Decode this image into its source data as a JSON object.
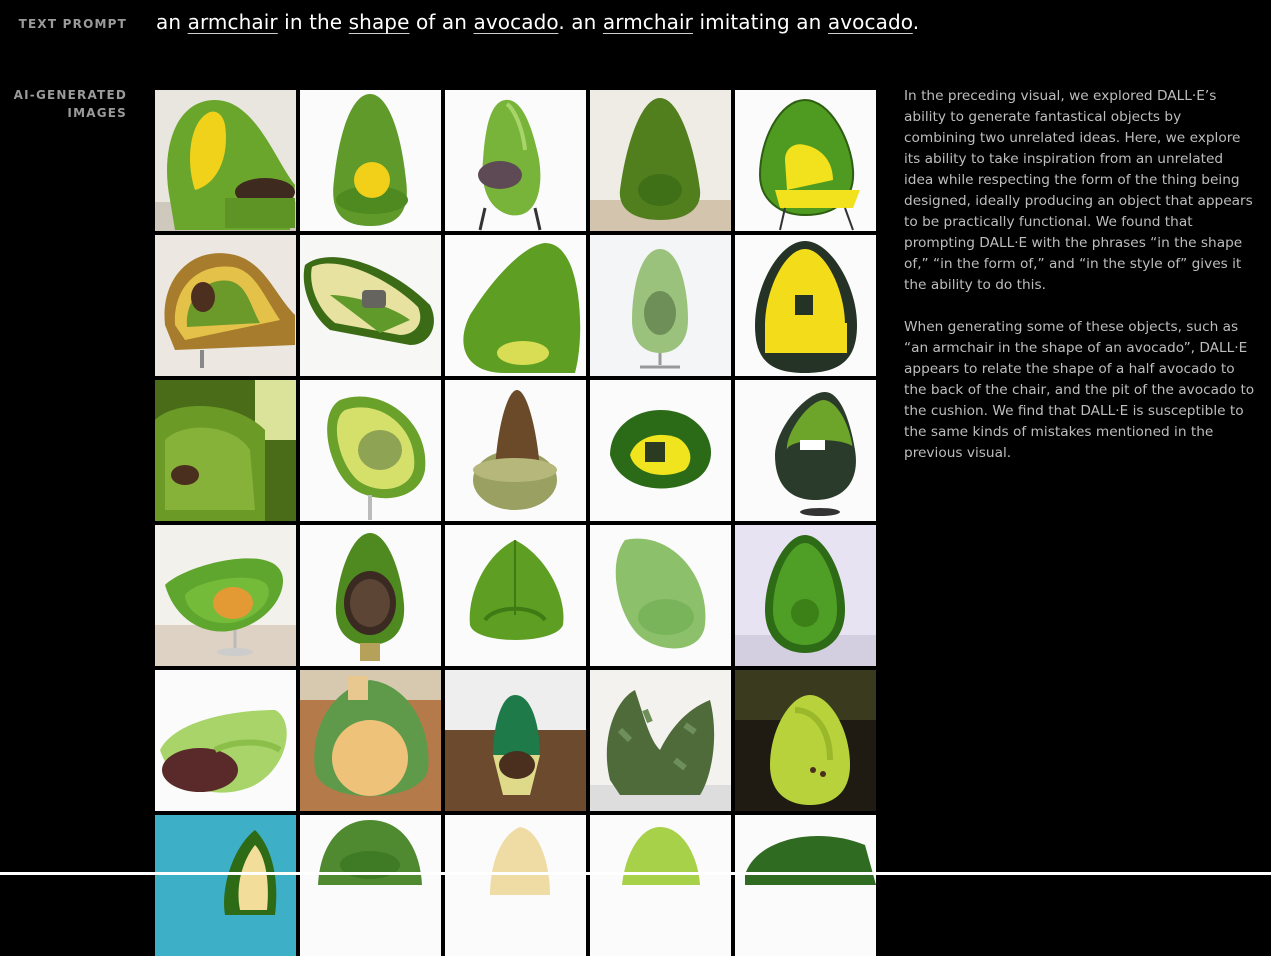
{
  "labels": {
    "text_prompt": "TEXT PROMPT",
    "ai_images": "AI-GENERATED IMAGES"
  },
  "prompt": {
    "parts": [
      "an ",
      "armchair",
      " in the ",
      "shape",
      " of an ",
      "avocado",
      ". an ",
      "armchair",
      " imitating an ",
      "avocado",
      "."
    ]
  },
  "description": {
    "p1": "In the preceding visual, we explored DALL·E’s ability to generate fantastical objects by combining two unrelated ideas. Here, we explore its ability to take inspiration from an unrelated idea while respecting the form of the thing being designed, ideally producing an object that appears to be practically functional. We found that prompting DALL·E with the phrases “in the shape of,” “in the form of,” and “in the style of” gives it the ability to do this.",
    "p2": "When generating some of these objects, such as “an armchair in the shape of an avocado”, DALL·E appears to relate the shape of a half avocado to the back of the chair, and the pit of the avocado to the cushion. We find that DALL·E is susceptible to the same kinds of mistakes mentioned in the previous visual."
  },
  "colors": {
    "background": "#000000",
    "label": "#9a9a9a",
    "body_text": "#bdbdbd",
    "avocado_green": "#5a9a2a",
    "avocado_yellow": "#e6d21a",
    "pit_brown": "#4a2e1e"
  }
}
